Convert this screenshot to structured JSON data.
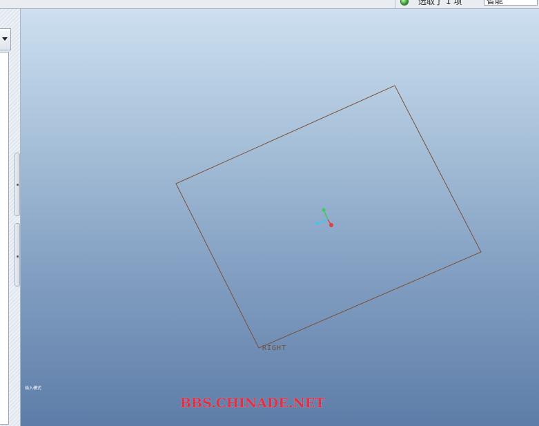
{
  "status_bar": {
    "selection_text": "选取了 1 项",
    "filter_value": "智能",
    "status_light_color": "#3da63a",
    "status_light_icon": "green-status-light-icon"
  },
  "model_tree": {
    "dropdown_icon": "chevron-down-icon"
  },
  "graphics": {
    "datum_plane_label": "RIGHT",
    "mode_text": "插入模式",
    "plane_edge_color": "#7a5038",
    "background_top_color": "#cddff0",
    "background_bottom_color": "#5d7da8",
    "axis_colors": {
      "x": "#e04040",
      "y": "#3ec95a",
      "z": "#39c8f0"
    }
  },
  "watermark": {
    "text": "BBS.CHINADE.NET",
    "color": "#d7344a"
  }
}
